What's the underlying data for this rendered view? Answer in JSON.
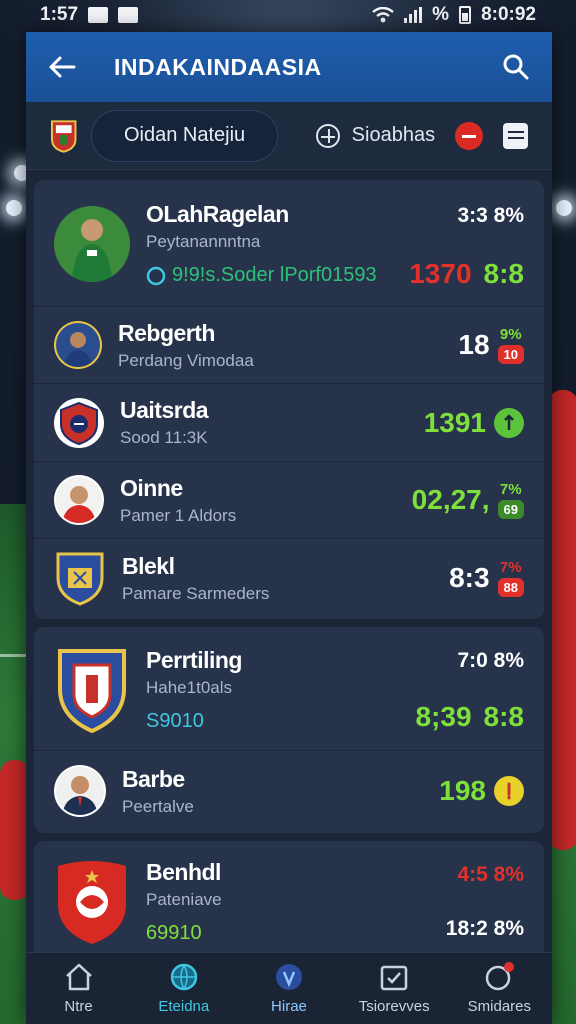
{
  "status_bar": {
    "time": "1:57",
    "right_time": "8:0:92",
    "percent": "%"
  },
  "app_bar": {
    "title": "INDAKAINDAASIA"
  },
  "sub_bar": {
    "league_label": "Oidan Natejiu",
    "filter_label": "Sioabhas"
  },
  "list": {
    "rows": [
      {
        "name": "OLahRagelan",
        "sub": "Peytanannntna",
        "extra": "9!9!s.Soder lPorf01593",
        "value": "1370",
        "value2": "8:8",
        "top": "3:3 8%"
      },
      {
        "name": "Rebgerth",
        "sub": "Perdang Vimodaa",
        "value": "18",
        "pct": "9%",
        "badge": "10"
      },
      {
        "name": "Uaitsrda",
        "sub": "Sood 11:3K",
        "value": "1391"
      },
      {
        "name": "Oinne",
        "sub": "Pamer 1 Aldors",
        "value": "02,27,",
        "pct": "7%",
        "badge": "69"
      },
      {
        "name": "Blekl",
        "sub": "Pamare Sarmeders",
        "value": "8:3",
        "pct": "7%",
        "badge": "88"
      },
      {
        "name": "Perrtiling",
        "sub": "Hahe1t0als",
        "extra": "S9010",
        "top": "7:0 8%",
        "value": "8;39",
        "value2": "8:8"
      },
      {
        "name": "Barbe",
        "sub": "Peertalve",
        "value": "198"
      },
      {
        "name": "Benhdl",
        "sub": "Pateniave",
        "extra": "69910",
        "top": "4:5 8%",
        "value": "18:2 8%"
      }
    ]
  },
  "nav": [
    {
      "label": "Ntre",
      "icon": "home-icon"
    },
    {
      "label": "Eteidna",
      "icon": "globe-icon"
    },
    {
      "label": "Hirae",
      "icon": "shield-icon"
    },
    {
      "label": "Tsiorevves",
      "icon": "calendar-check-icon"
    },
    {
      "label": "Smidares",
      "icon": "chat-icon"
    }
  ],
  "colors": {
    "app_bar": "#1f5fae",
    "green": "#7fe03b",
    "red": "#e2312b",
    "cyan": "#4fc3e0",
    "panel": "#26334a"
  }
}
